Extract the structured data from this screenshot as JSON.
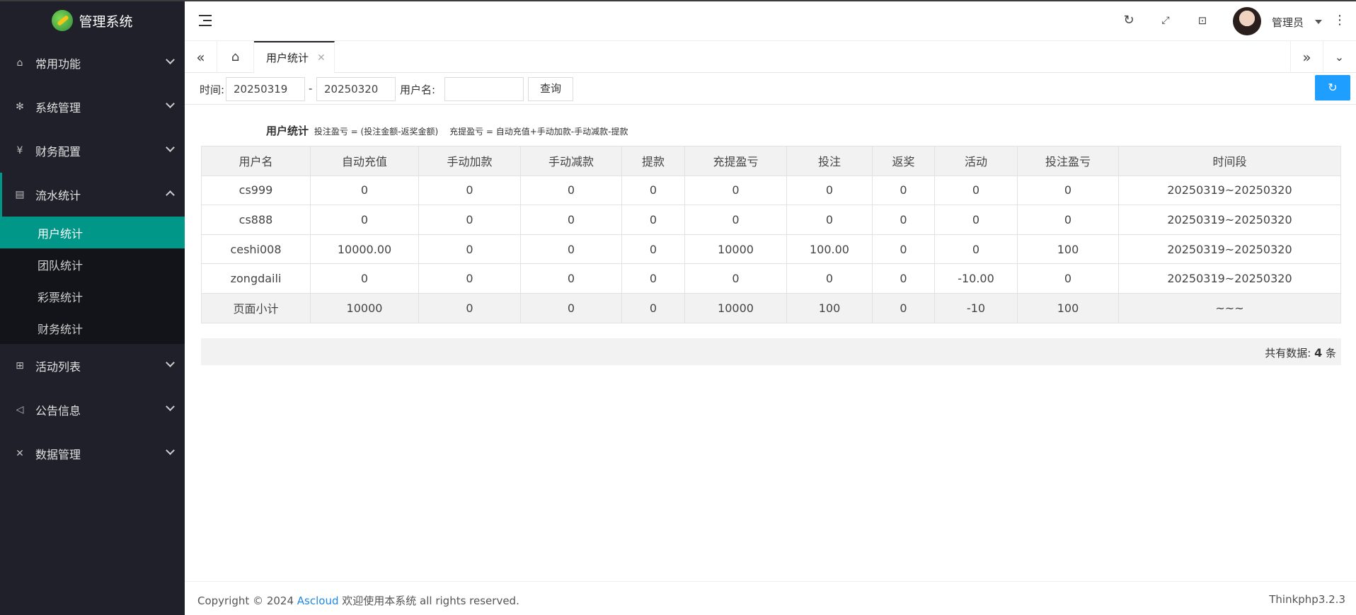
{
  "app": {
    "title": "管理系统"
  },
  "sidebar": {
    "menu": [
      {
        "label": "常用功能",
        "icon": "home-icon"
      },
      {
        "label": "系统管理",
        "icon": "gear-icon"
      },
      {
        "label": "财务配置",
        "icon": "yen-icon"
      },
      {
        "label": "流水统计",
        "icon": "document-icon"
      },
      {
        "label": "活动列表",
        "icon": "gift-icon"
      },
      {
        "label": "公告信息",
        "icon": "speaker-icon"
      },
      {
        "label": "数据管理",
        "icon": "tools-icon"
      }
    ],
    "submenu": [
      "用户统计",
      "团队统计",
      "彩票统计",
      "财务统计"
    ],
    "active_sub": "用户统计"
  },
  "header": {
    "user_name": "管理员"
  },
  "tabs": {
    "active": "用户统计"
  },
  "filter": {
    "time_label": "时间:",
    "start": "20250319",
    "separator": "-",
    "end": "20250320",
    "user_label": "用户名:",
    "user_value": "",
    "query_label": "查询"
  },
  "content": {
    "title": "用户统计",
    "note1": "投注盈亏 = (投注金额-返奖金额)",
    "note2": "充提盈亏 = 自动充值+手动加款-手动减款-提款",
    "columns": [
      "用户名",
      "自动充值",
      "手动加款",
      "手动减款",
      "提款",
      "充提盈亏",
      "投注",
      "返奖",
      "活动",
      "投注盈亏",
      "时间段"
    ],
    "rows": [
      [
        "cs999",
        "0",
        "0",
        "0",
        "0",
        "0",
        "0",
        "0",
        "0",
        "0",
        "20250319~20250320"
      ],
      [
        "cs888",
        "0",
        "0",
        "0",
        "0",
        "0",
        "0",
        "0",
        "0",
        "0",
        "20250319~20250320"
      ],
      [
        "ceshi008",
        "10000.00",
        "0",
        "0",
        "0",
        "10000",
        "100.00",
        "0",
        "0",
        "100",
        "20250319~20250320"
      ],
      [
        "zongdaili",
        "0",
        "0",
        "0",
        "0",
        "0",
        "0",
        "0",
        "-10.00",
        "0",
        "20250319~20250320"
      ]
    ],
    "subtotal": [
      "页面小计",
      "10000",
      "0",
      "0",
      "0",
      "10000",
      "100",
      "0",
      "-10",
      "100",
      "~~~"
    ],
    "total_prefix": "共有数据:",
    "total_count": "4",
    "total_suffix": "条"
  },
  "footer": {
    "copyright_prefix": "Copyright © 2024",
    "brand": "Ascloud",
    "copyright_suffix": "欢迎使用本系统 all rights reserved.",
    "version": "Thinkphp3.2.3"
  }
}
